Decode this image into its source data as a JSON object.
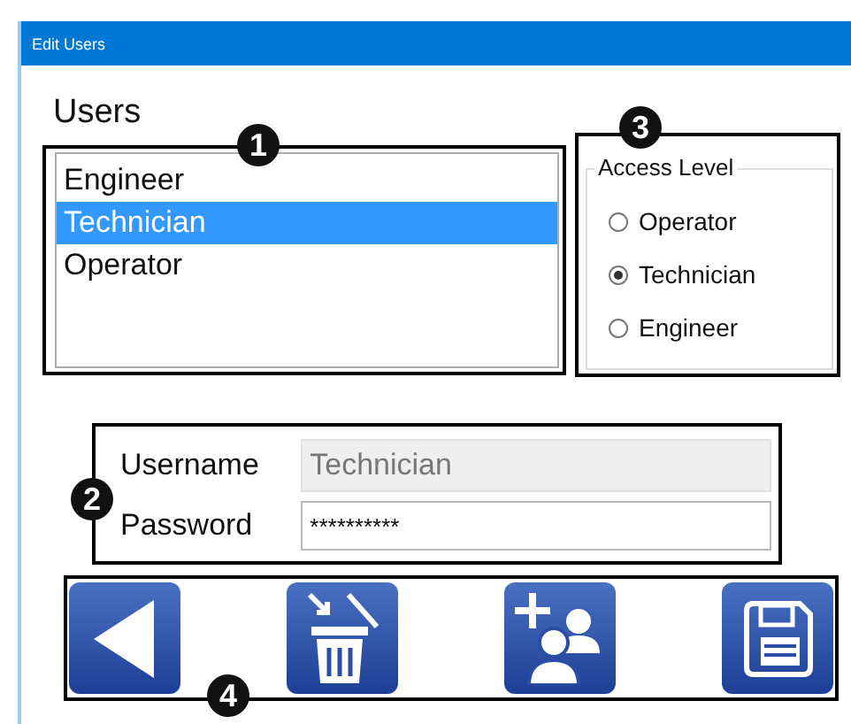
{
  "window": {
    "title": "Edit Users"
  },
  "users": {
    "heading": "Users",
    "callout": "1",
    "items": [
      {
        "label": "Engineer",
        "selected": false
      },
      {
        "label": "Technician",
        "selected": true
      },
      {
        "label": "Operator",
        "selected": false
      }
    ]
  },
  "access_level": {
    "title": "Access Level",
    "callout": "3",
    "options": [
      {
        "label": "Operator",
        "selected": false
      },
      {
        "label": "Technician",
        "selected": true
      },
      {
        "label": "Engineer",
        "selected": false
      }
    ]
  },
  "login": {
    "callout": "2",
    "fields": [
      {
        "label": "Username",
        "value": "Technician",
        "disabled": true
      },
      {
        "label": "Password",
        "value": "**********",
        "disabled": false
      }
    ]
  },
  "toolbar": {
    "callout": "4",
    "buttons": [
      {
        "kind": "back"
      },
      {
        "kind": "delete"
      },
      {
        "kind": "add_user"
      },
      {
        "kind": "save"
      }
    ]
  }
}
